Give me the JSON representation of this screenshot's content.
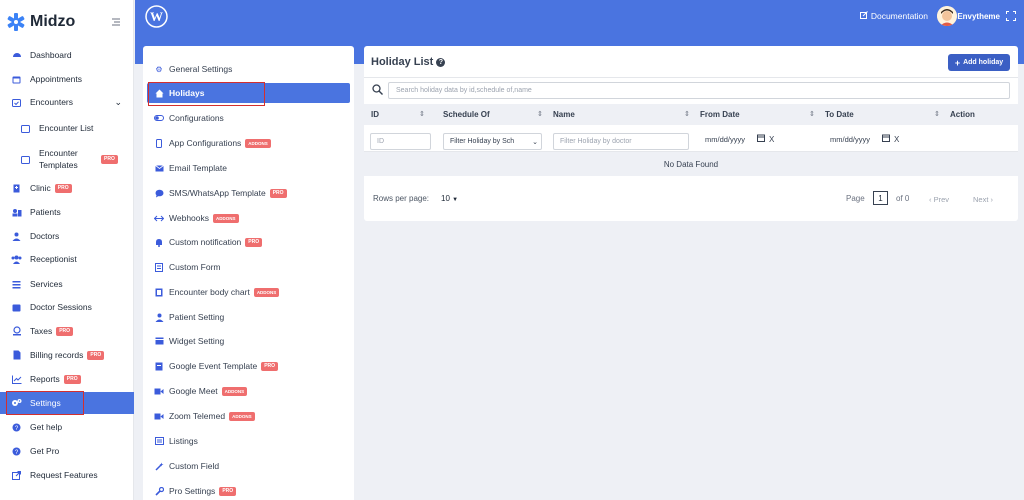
{
  "brand": {
    "name": "Midzo",
    "logo_icon": "medical-star-icon",
    "accent": "#4a74e0"
  },
  "sidebar": {
    "items": [
      {
        "label": "Dashboard",
        "icon": "dashboard-icon"
      },
      {
        "label": "Appointments",
        "icon": "calendar-icon"
      },
      {
        "label": "Encounters",
        "icon": "calendar-check-icon"
      },
      {
        "label": "Encounter List",
        "icon": "calendar-icon"
      },
      {
        "label": "Encounter Templates",
        "icon": "calendar-outline-icon",
        "badge": "PRO"
      },
      {
        "label": "Clinic",
        "icon": "hospital-icon",
        "badge": "PRO"
      },
      {
        "label": "Patients",
        "icon": "users-icon"
      },
      {
        "label": "Doctors",
        "icon": "doctor-icon"
      },
      {
        "label": "Receptionist",
        "icon": "group-icon"
      },
      {
        "label": "Services",
        "icon": "list-icon"
      },
      {
        "label": "Doctor Sessions",
        "icon": "calendar-icon"
      },
      {
        "label": "Taxes",
        "icon": "tax-icon",
        "badge": "PRO"
      },
      {
        "label": "Billing records",
        "icon": "file-icon",
        "badge": "PRO"
      },
      {
        "label": "Reports",
        "icon": "chart-icon",
        "badge": "PRO"
      },
      {
        "label": "Settings",
        "icon": "gears-icon",
        "active": true
      },
      {
        "label": "Get help",
        "icon": "help-icon"
      },
      {
        "label": "Get Pro",
        "icon": "help-icon"
      },
      {
        "label": "Request Features",
        "icon": "external-link-icon"
      }
    ]
  },
  "topbar": {
    "documentation": "Documentation",
    "user_name": "Envytheme"
  },
  "settings_menu": {
    "items": [
      {
        "label": "General Settings",
        "icon": "gears-icon"
      },
      {
        "label": "Holidays",
        "icon": "home-icon",
        "active": true
      },
      {
        "label": "Configurations",
        "icon": "toggle-icon"
      },
      {
        "label": "App Configurations",
        "icon": "mobile-icon",
        "badge": "ADDONS"
      },
      {
        "label": "Email Template",
        "icon": "email-icon"
      },
      {
        "label": "SMS/WhatsApp Template",
        "icon": "chat-icon",
        "badge": "PRO"
      },
      {
        "label": "Webhooks",
        "icon": "webhook-icon",
        "badge": "ADDONS"
      },
      {
        "label": "Custom notification",
        "icon": "bell-icon",
        "badge": "PRO"
      },
      {
        "label": "Custom Form",
        "icon": "form-icon"
      },
      {
        "label": "Encounter body chart",
        "icon": "body-chart-icon",
        "badge": "ADDONS"
      },
      {
        "label": "Patient Setting",
        "icon": "patient-icon"
      },
      {
        "label": "Widget Setting",
        "icon": "widget-icon"
      },
      {
        "label": "Google Event Template",
        "icon": "event-icon",
        "badge": "PRO"
      },
      {
        "label": "Google Meet",
        "icon": "video-icon",
        "badge": "ADDONS"
      },
      {
        "label": "Zoom Telemed",
        "icon": "video-icon",
        "badge": "ADDONS"
      },
      {
        "label": "Listings",
        "icon": "listing-icon"
      },
      {
        "label": "Custom Field",
        "icon": "magic-icon"
      },
      {
        "label": "Pro Settings",
        "icon": "wrench-icon",
        "badge": "PRO"
      }
    ]
  },
  "holiday": {
    "title": "Holiday List",
    "add_button": "Add holiday",
    "search_placeholder": "Search holiday data by id,schedule of,name",
    "columns": {
      "id": "ID",
      "schedule_of": "Schedule Of",
      "name": "Name",
      "from_date": "From Date",
      "to_date": "To Date",
      "action": "Action"
    },
    "filters": {
      "id_placeholder": "ID",
      "schedule_select": "Filter Holiday by Sch",
      "name_placeholder": "Filter Holiday by doctor",
      "from_date": "mm/dd/yyyy",
      "to_date": "mm/dd/yyyy",
      "clear": "X"
    },
    "empty_text": "No Data Found",
    "footer": {
      "rows_per_page_label": "Rows per page:",
      "rows_per_page_value": "10",
      "page_label": "Page",
      "page_value": "1",
      "of_label": "of 0",
      "prev": "Prev",
      "next": "Next"
    }
  }
}
